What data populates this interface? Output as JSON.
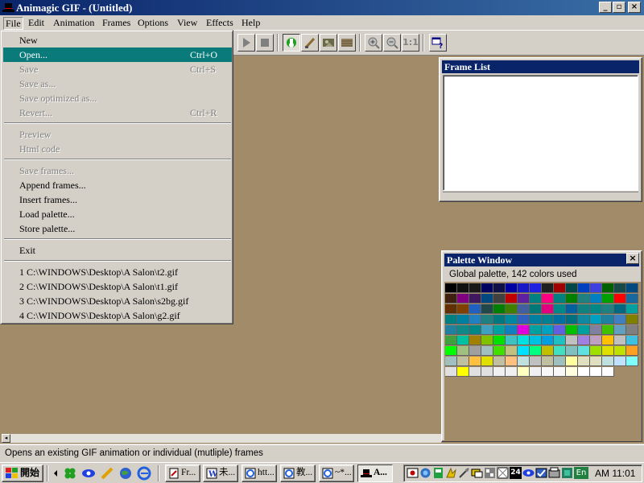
{
  "window": {
    "title": "Animagic GIF - (Untitled)",
    "minimize_glyph": "_",
    "maximize_glyph": "▫",
    "close_glyph": "×"
  },
  "menubar": {
    "items": [
      {
        "label": "File",
        "accel": "F"
      },
      {
        "label": "Edit",
        "accel": "E"
      },
      {
        "label": "Animation",
        "accel": "A"
      },
      {
        "label": "Frames",
        "accel": "m"
      },
      {
        "label": "Options",
        "accel": "O"
      },
      {
        "label": "View",
        "accel": "V"
      },
      {
        "label": "Effects",
        "accel": "E"
      },
      {
        "label": "Help",
        "accel": "H"
      }
    ]
  },
  "toolbar": {
    "icons": [
      "play-icon",
      "stop-icon",
      "green-hand-icon",
      "brush-icon",
      "image-icon",
      "texture-icon",
      "zoom-in-icon",
      "zoom-out-icon",
      "actual-size-icon",
      "help-context-icon"
    ],
    "actual_size_label": "1:1"
  },
  "file_menu": {
    "items": [
      {
        "label": "New",
        "shortcut": "",
        "disabled": false
      },
      {
        "label": "Open...",
        "shortcut": "Ctrl+O",
        "disabled": false,
        "highlighted": true
      },
      {
        "label": "Save",
        "shortcut": "Ctrl+S",
        "disabled": true
      },
      {
        "label": "Save as...",
        "shortcut": "",
        "disabled": true
      },
      {
        "label": "Save optimized as...",
        "shortcut": "",
        "disabled": true
      },
      {
        "label": "Revert...",
        "shortcut": "Ctrl+R",
        "disabled": true
      },
      {
        "label": "Preview",
        "shortcut": "",
        "disabled": true
      },
      {
        "label": "Html code",
        "shortcut": "",
        "disabled": true
      },
      {
        "label": "Save frames...",
        "shortcut": "",
        "disabled": true
      },
      {
        "label": "Append frames...",
        "shortcut": "",
        "disabled": false
      },
      {
        "label": "Insert frames...",
        "shortcut": "",
        "disabled": false
      },
      {
        "label": "Load palette...",
        "shortcut": "",
        "disabled": false
      },
      {
        "label": "Store palette...",
        "shortcut": "",
        "disabled": false
      },
      {
        "label": "Exit",
        "shortcut": "",
        "disabled": false
      },
      {
        "label": "1 C:\\WINDOWS\\Desktop\\A  Salon\\t2.gif",
        "shortcut": "",
        "disabled": false
      },
      {
        "label": "2 C:\\WINDOWS\\Desktop\\A  Salon\\t1.gif",
        "shortcut": "",
        "disabled": false
      },
      {
        "label": "3 C:\\WINDOWS\\Desktop\\A  Salon\\s2bg.gif",
        "shortcut": "",
        "disabled": false
      },
      {
        "label": "4 C:\\WINDOWS\\Desktop\\A  Salon\\g2.gif",
        "shortcut": "",
        "disabled": false
      }
    ]
  },
  "frame_list": {
    "title": "Frame List"
  },
  "palette_window": {
    "title": "Palette Window",
    "close_glyph": "×",
    "info": "Global palette, 142 colors used",
    "colors": [
      "#000000",
      "#101010",
      "#181818",
      "#000060",
      "#101048",
      "#0000a0",
      "#1818c8",
      "#2020e0",
      "#202020",
      "#a00000",
      "#004848",
      "#0040c0",
      "#4040e0",
      "#006000",
      "#184848",
      "#004880",
      "#402010",
      "#800080",
      "#401860",
      "#004880",
      "#404040",
      "#c00000",
      "#6020a0",
      "#008080",
      "#ff0080",
      "#008080",
      "#008000",
      "#208080",
      "#0080c0",
      "#00a000",
      "#ff0000",
      "#1868a0",
      "#603000",
      "#804000",
      "#2060c0",
      "#204848",
      "#008000",
      "#408000",
      "#4060a0",
      "#007878",
      "#e00080",
      "#008888",
      "#0060a0",
      "#108080",
      "#008888",
      "#208080",
      "#006880",
      "#00a0a0",
      "#008080",
      "#0080a0",
      "#2080c0",
      "#208080",
      "#007880",
      "#0088a0",
      "#3060c0",
      "#0080a0",
      "#008090",
      "#0070a0",
      "#007080",
      "#1088a0",
      "#00a0c0",
      "#2080a0",
      "#4080c0",
      "#808000",
      "#2080a0",
      "#108888",
      "#008888",
      "#40a0c0",
      "#00a0a0",
      "#1080c0",
      "#e000e0",
      "#00a0a0",
      "#00a0c0",
      "#6060e0",
      "#00c000",
      "#00a0a0",
      "#8080a0",
      "#40c000",
      "#60a0c0",
      "#808080",
      "#40a040",
      "#00c0a0",
      "#a08000",
      "#80c000",
      "#00e000",
      "#40c0c0",
      "#00e0e0",
      "#00c0e0",
      "#00a0e0",
      "#20c0c0",
      "#c0c0c0",
      "#a080e0",
      "#c0a0c0",
      "#ffc000",
      "#c0c0c0",
      "#40c0e0",
      "#00ff00",
      "#a0c080",
      "#a0a0a0",
      "#a0c0c0",
      "#40e000",
      "#c0c080",
      "#00e0ff",
      "#00ff80",
      "#c0c000",
      "#40e0c0",
      "#80c0c0",
      "#60e0e0",
      "#a0e000",
      "#e0e000",
      "#c0e000",
      "#ffa020",
      "#a0c0c0",
      "#c0c0a0",
      "#ffc040",
      "#e0e000",
      "#c0c0a0",
      "#ffc080",
      "#c0e0e0",
      "#c0c0c0",
      "#c0c0a0",
      "#a0c0c0",
      "#ffffa0",
      "#e0e0c0",
      "#e0e0c0",
      "#c0e0e0",
      "#c0e0ff",
      "#80ffff",
      "#e0e0e0",
      "#ffff00",
      "#e0e0e0",
      "#e0e0e0",
      "#f0f0f0",
      "#f0f0f0",
      "#ffffc0",
      "#f0f0f0",
      "#f8f8f8",
      "#f8f8f8",
      "#ffffe0",
      "#ffffff",
      "#ffffff",
      "#fcfcfc"
    ]
  },
  "statusbar": {
    "text": "Opens an existing GIF animation or individual (mutliple) frames"
  },
  "taskbar": {
    "start_label": "開始",
    "quick_launch": [
      "arrow-icon",
      "clover-icon",
      "eye-icon",
      "pencil-icon",
      "globe-icon",
      "ie-icon"
    ],
    "tasks": [
      {
        "label": "Fr...",
        "icon": "document-icon",
        "active": false
      },
      {
        "label": "未...",
        "icon": "word-icon",
        "active": false
      },
      {
        "label": "htt...",
        "icon": "browser-icon",
        "active": false
      },
      {
        "label": "教...",
        "icon": "browser-icon",
        "active": false
      },
      {
        "label": "~*...",
        "icon": "browser-icon",
        "active": false
      },
      {
        "label": "A...",
        "icon": "hat-icon",
        "active": true
      }
    ],
    "tray_icons": [
      "tray-icon-1",
      "tray-icon-2",
      "tray-icon-3",
      "tray-icon-4",
      "tray-icon-5",
      "tray-icon-6",
      "tray-icon-7",
      "tray-icon-8",
      "tray-icon-9",
      "tray-icon-10",
      "tray-icon-11",
      "tray-icon-12",
      "tray-icon-13",
      "tray-icon-14"
    ],
    "tray_24_label": "24",
    "tray_en_label": "En",
    "clock": "AM 11:01"
  }
}
